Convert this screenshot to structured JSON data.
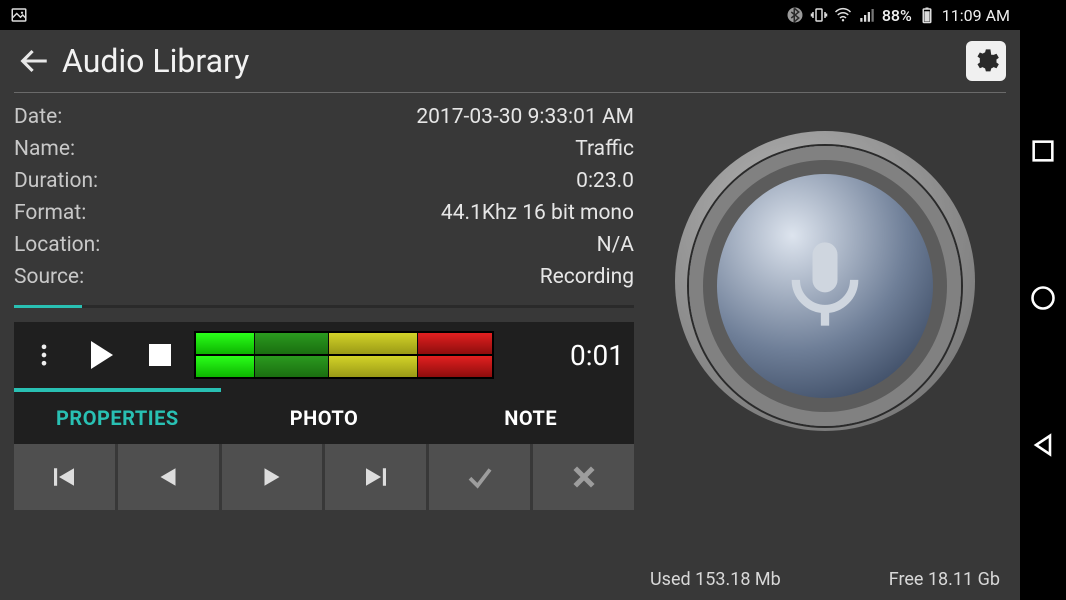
{
  "statusbar": {
    "battery_pct": "88%",
    "time": "11:09 AM"
  },
  "header": {
    "title": "Audio Library"
  },
  "properties": {
    "date_label": "Date:",
    "date_value": "2017-03-30 9:33:01 AM",
    "name_label": "Name:",
    "name_value": "Traffic",
    "dur_label": "Duration:",
    "dur_value": "0:23.0",
    "fmt_label": "Format:",
    "fmt_value": "44.1Khz 16 bit mono",
    "loc_label": "Location:",
    "loc_value": "N/A",
    "src_label": "Source:",
    "src_value": "Recording"
  },
  "playback": {
    "elapsed": "0:01"
  },
  "tabs": {
    "properties": "PROPERTIES",
    "photo": "PHOTO",
    "note": "NOTE"
  },
  "storage": {
    "used": "Used 153.18 Mb",
    "free": "Free 18.11 Gb"
  }
}
